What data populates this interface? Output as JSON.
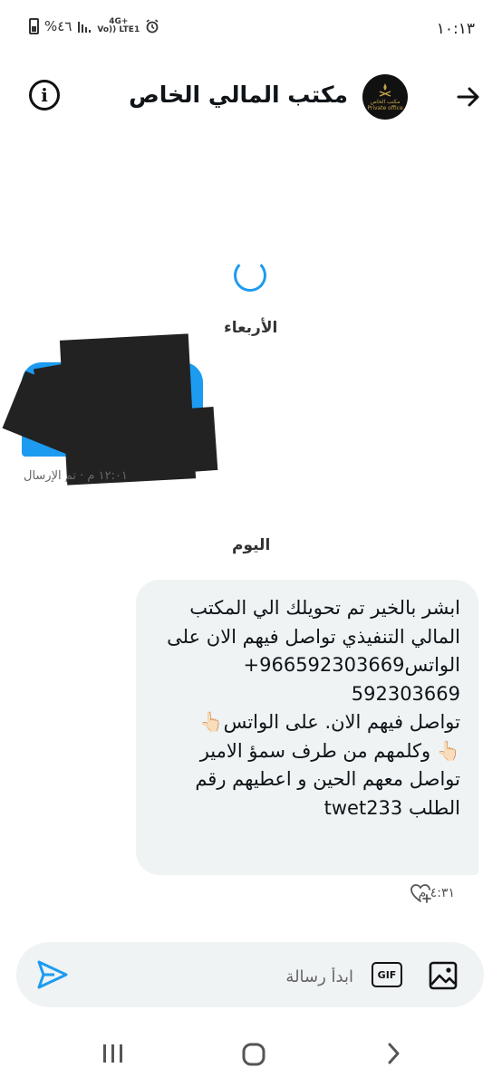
{
  "status_bar": {
    "time": "١٠:١٣",
    "battery": "%٤٦",
    "network_top": "4G+",
    "network_bottom": "Vo)) LTE1",
    "icons": [
      "battery-icon",
      "signal-icon",
      "network-icon",
      "alarm-icon"
    ]
  },
  "header": {
    "title": "مكتب المالي الخاص",
    "avatar_text": "مكتب الخاص Private office",
    "icons": [
      "info-icon",
      "back-arrow-icon"
    ]
  },
  "conversation": {
    "earlier": {
      "day_label": "الأربعاء",
      "sent_meta": "١٢:٠١ م · تم الإرسال"
    },
    "today": {
      "day_label": "اليوم",
      "message_lines": [
        "ابشر بالخير  تم  تحويلك   الي المكتب",
        "المالي التنفيذي تواصل فيهم الان على",
        "الواتس966592303669+",
        "592303669",
        " تواصل فيهم الان. على الواتس👆🏻",
        "👆🏻 وكلمهم من طرف سمؤ الامير",
        "تواصل معهم الحين و  اعطيهم رقم",
        "الطلب  twet233"
      ],
      "sent_time": "٤:٣١ م"
    }
  },
  "composer": {
    "placeholder": "ابدأ رسالة",
    "gif_label": "GIF",
    "icons": [
      "send-icon",
      "image-icon"
    ]
  },
  "colors": {
    "accent": "#1d9bf0",
    "bubble_bg": "#eff3f4",
    "text": "#0f1419"
  }
}
